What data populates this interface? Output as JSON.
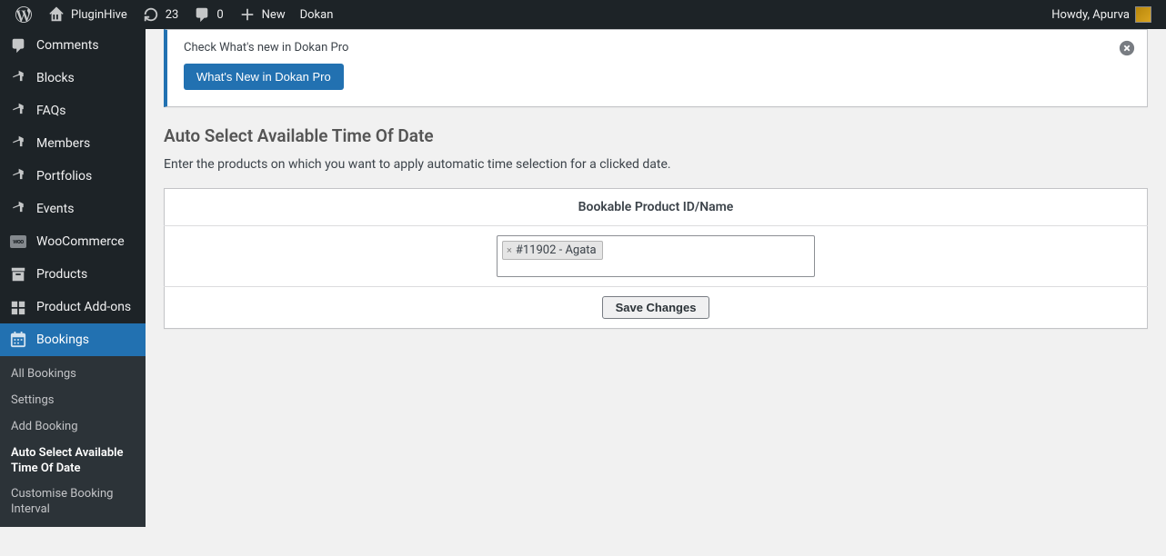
{
  "adminbar": {
    "site_name": "PluginHive",
    "updates_count": "23",
    "comments_count": "0",
    "new_label": "New",
    "extra_link": "Dokan",
    "howdy": "Howdy, Apurva"
  },
  "sidebar": {
    "items": [
      {
        "label": "Comments"
      },
      {
        "label": "Blocks"
      },
      {
        "label": "FAQs"
      },
      {
        "label": "Members"
      },
      {
        "label": "Portfolios"
      },
      {
        "label": "Events"
      },
      {
        "label": "WooCommerce"
      },
      {
        "label": "Products"
      },
      {
        "label": "Product Add-ons"
      },
      {
        "label": "Bookings"
      }
    ],
    "submenu": [
      {
        "label": "All Bookings"
      },
      {
        "label": "Settings"
      },
      {
        "label": "Add Booking"
      },
      {
        "label": "Auto Select Available Time Of Date"
      },
      {
        "label": "Customise Booking Interval"
      }
    ]
  },
  "notice": {
    "text": "Check What's new in Dokan Pro",
    "button": "What's New in Dokan Pro"
  },
  "page": {
    "title": "Auto Select Available Time Of Date",
    "description": "Enter the products on which you want to apply automatic time selection for a clicked date.",
    "table_header": "Bookable Product ID/Name",
    "token_value": "#11902 - Agata",
    "save_button": "Save Changes"
  }
}
